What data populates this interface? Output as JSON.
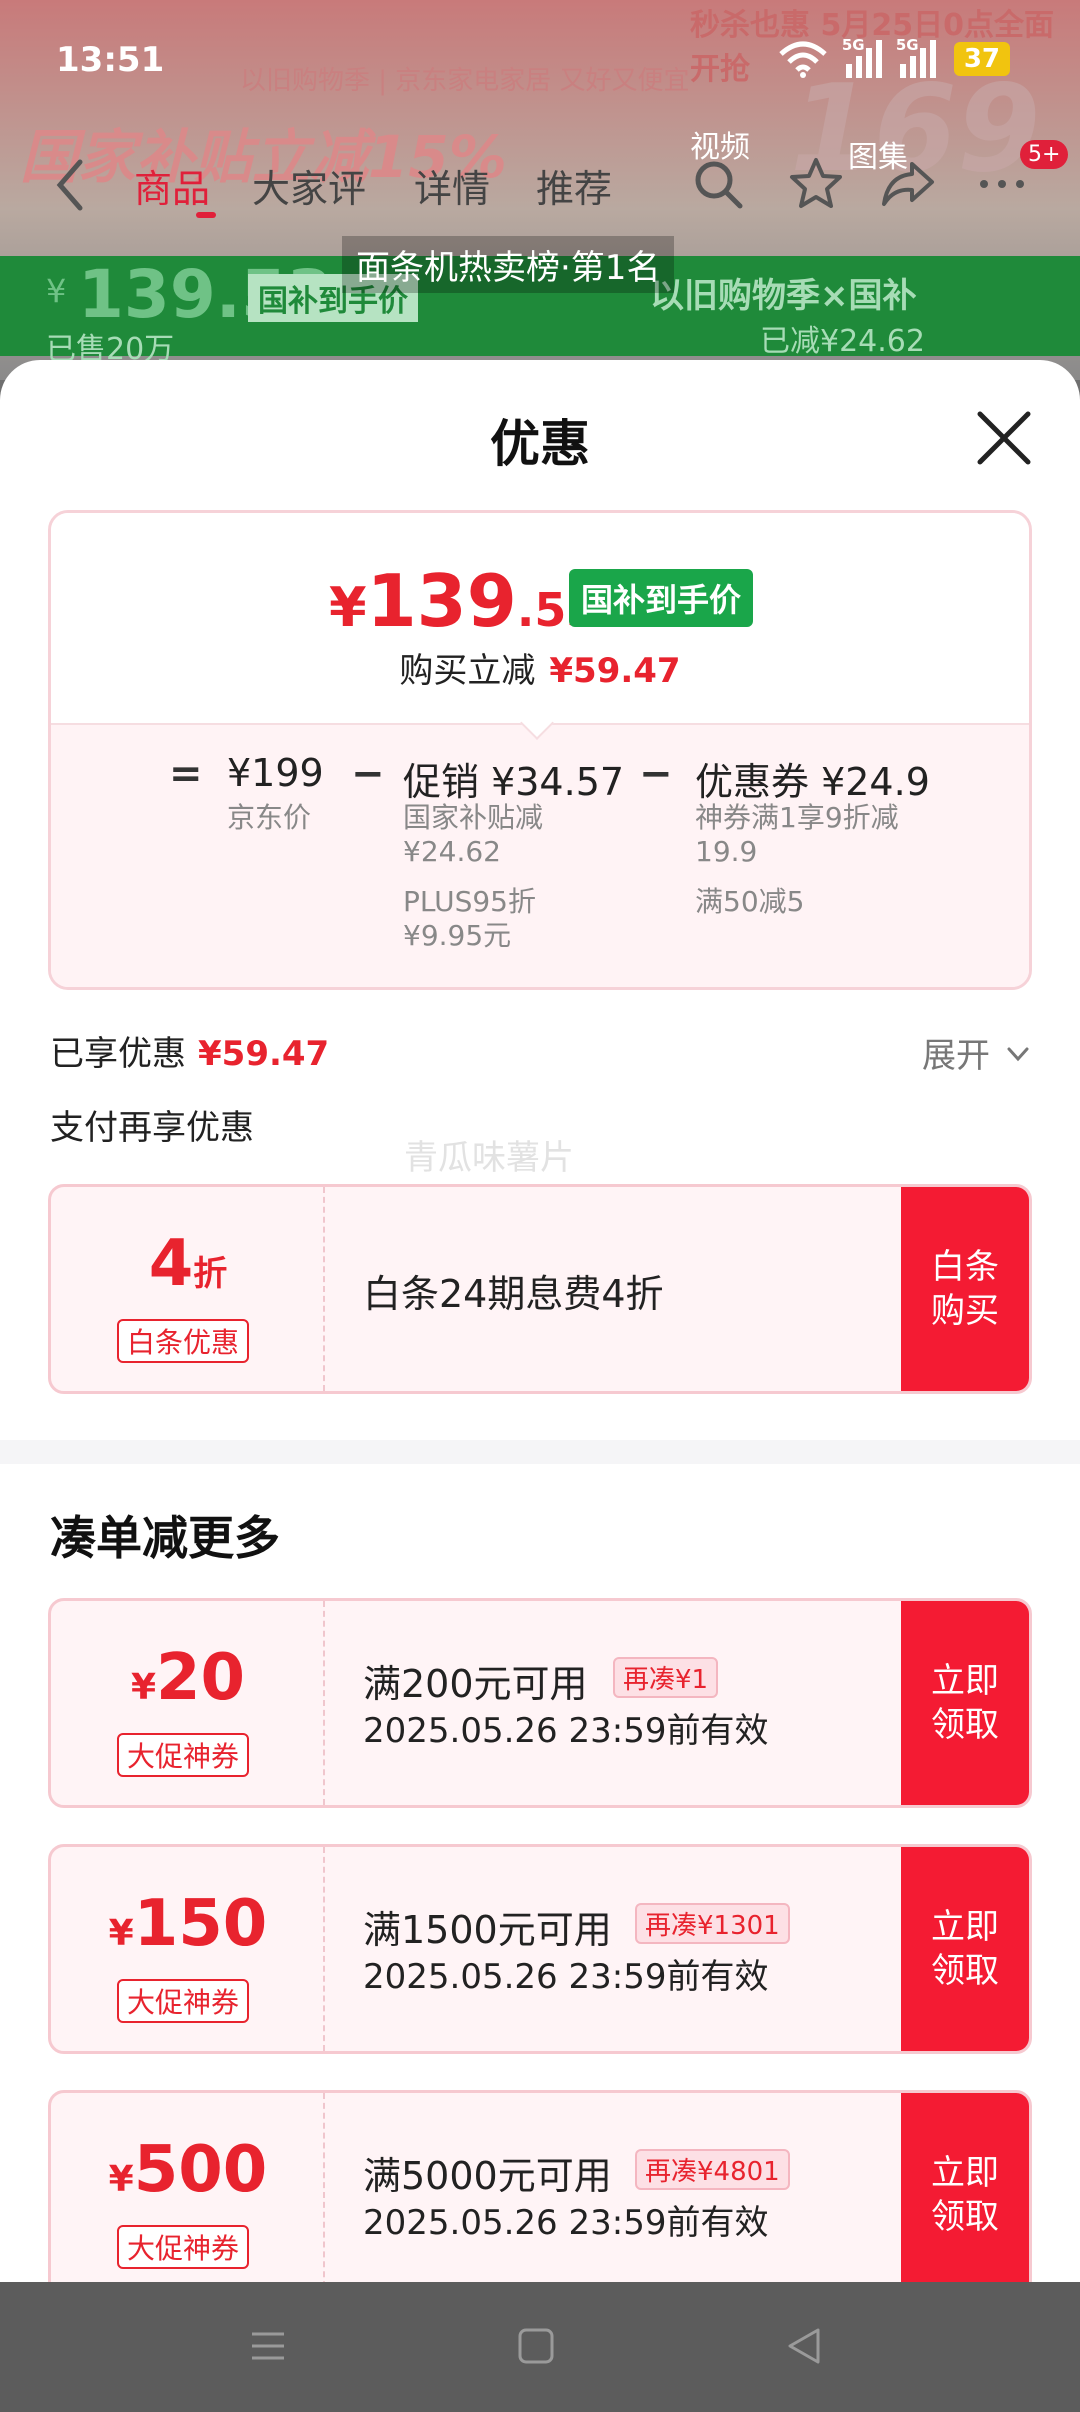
{
  "status_bar": {
    "time": "13:51",
    "net1": "5G",
    "net2": "5G",
    "battery": "37"
  },
  "background": {
    "banner_top": "秒杀也惠 5月25日0点全面开抢",
    "banner_sub": "以旧购物季 | 京东家电家居 又好又便宜",
    "banner_main": "国家补贴立减15%",
    "big_num": "169",
    "video_label": "视频",
    "image_label": "图集",
    "tabs": [
      "商品",
      "大家评",
      "详情",
      "推荐"
    ],
    "cart_badge": "5+",
    "bangdan": "面条机热卖榜·第1名",
    "price_yuan": "¥",
    "price_num": "139.53",
    "price_tag": "国补到手价",
    "season": "以旧购物季×国补",
    "reduced": "已减¥24.62",
    "sold": "已售20万"
  },
  "sheet": {
    "title": "优惠",
    "final_price": {
      "yuan": "¥",
      "int": "139",
      "dec": ".53"
    },
    "guobu_tag": "国补到手价",
    "save_label": "购买立减",
    "save_value": "¥59.47",
    "breakdown": {
      "eq": "=",
      "minus1": "−",
      "minus2": "−",
      "jd_price": "¥199",
      "jd_label": "京东价",
      "promo_main": "促销 ¥34.57",
      "promo_sub1": "国家补贴减",
      "promo_sub2": "¥24.62",
      "promo_sub3": "PLUS95折",
      "promo_sub4": "¥9.95元",
      "coupon_main": "优惠券 ¥24.9",
      "coupon_sub1": "神券满1享9折减",
      "coupon_sub2": "19.9",
      "coupon_sub3": "满50减5"
    },
    "enjoyed_label": "已享优惠",
    "enjoyed_value": "¥59.47",
    "expand_label": "展开",
    "pay_more_label": "支付再享优惠",
    "watermark": "青瓜味薯片",
    "baitiao": {
      "num": "4",
      "unit": "折",
      "tag": "白条优惠",
      "desc": "白条24期息费4折",
      "action": "白条购买"
    },
    "more_title": "凑单减更多",
    "coupons": [
      {
        "yuan": "¥",
        "amount": "20",
        "tag": "大促神券",
        "condition": "满200元可用",
        "need": "再凑¥1",
        "expiry": "2025.05.26 23:59前有效",
        "action": "立即领取"
      },
      {
        "yuan": "¥",
        "amount": "150",
        "tag": "大促神券",
        "condition": "满1500元可用",
        "need": "再凑¥1301",
        "expiry": "2025.05.26 23:59前有效",
        "action": "立即领取"
      },
      {
        "yuan": "¥",
        "amount": "500",
        "tag": "大促神券",
        "condition": "满5000元可用",
        "need": "再凑¥4801",
        "expiry": "2025.05.26 23:59前有效",
        "action": "立即领取"
      }
    ]
  },
  "colors": {
    "accent_red": "#e8232e",
    "button_red": "#f41b33",
    "guobu_green": "#1aa64a"
  },
  "icons": [
    "back-icon",
    "search-icon",
    "star-icon",
    "share-icon",
    "more-icon",
    "close-icon",
    "chevron-down-icon",
    "menu-icon",
    "home-icon",
    "back-triangle-icon"
  ]
}
